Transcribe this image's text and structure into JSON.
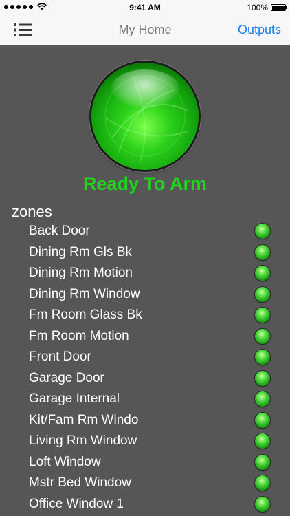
{
  "status_bar": {
    "time": "9:41 AM",
    "battery": "100%"
  },
  "nav": {
    "title": "My Home",
    "right_button": "Outputs",
    "menu_icon": "list-icon"
  },
  "status": {
    "label": "Ready To Arm",
    "color": "#22d21e"
  },
  "zones": {
    "header": "zones",
    "items": [
      {
        "name": "Back Door"
      },
      {
        "name": "Dining Rm Gls Bk"
      },
      {
        "name": "Dining Rm Motion"
      },
      {
        "name": "Dining Rm Window"
      },
      {
        "name": "Fm Room Glass Bk"
      },
      {
        "name": "Fm Room Motion"
      },
      {
        "name": "Front Door"
      },
      {
        "name": "Garage Door"
      },
      {
        "name": "Garage Internal"
      },
      {
        "name": "Kit/Fam Rm Windo"
      },
      {
        "name": "Living Rm Window"
      },
      {
        "name": "Loft Window"
      },
      {
        "name": "Mstr Bed Window"
      },
      {
        "name": "Office Window 1"
      }
    ]
  }
}
